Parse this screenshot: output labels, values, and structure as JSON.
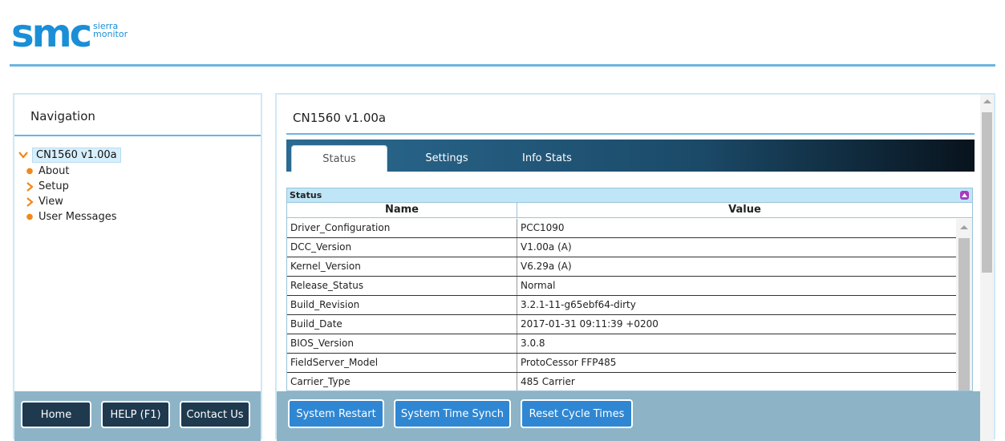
{
  "brand": {
    "logo_text": "smc",
    "logo_sub_line1": "sierra",
    "logo_sub_line2": "monitor",
    "color": "#1a8fd8"
  },
  "nav": {
    "title": "Navigation",
    "root": "CN1560 v1.00a",
    "items": [
      {
        "label": "About",
        "icon": "bullet-icon"
      },
      {
        "label": "Setup",
        "icon": "chevron-right-icon"
      },
      {
        "label": "View",
        "icon": "chevron-right-icon"
      },
      {
        "label": "User Messages",
        "icon": "bullet-icon"
      }
    ],
    "buttons": {
      "home": "Home",
      "help": "HELP (F1)",
      "contact": "Contact Us"
    }
  },
  "main": {
    "title": "CN1560 v1.00a",
    "tabs": [
      {
        "label": "Status",
        "active": true
      },
      {
        "label": "Settings",
        "active": false
      },
      {
        "label": "Info Stats",
        "active": false
      }
    ],
    "status": {
      "heading": "Status",
      "col_name": "Name",
      "col_value": "Value",
      "rows": [
        {
          "name": "Driver_Configuration",
          "value": "PCC1090"
        },
        {
          "name": "DCC_Version",
          "value": "V1.00a (A)"
        },
        {
          "name": "Kernel_Version",
          "value": "V6.29a (A)"
        },
        {
          "name": "Release_Status",
          "value": "Normal"
        },
        {
          "name": "Build_Revision",
          "value": "3.2.1-11-g65ebf64-dirty"
        },
        {
          "name": "Build_Date",
          "value": "2017-01-31 09:11:39 +0200"
        },
        {
          "name": "BIOS_Version",
          "value": "3.0.8"
        },
        {
          "name": "FieldServer_Model",
          "value": "ProtoCessor FFP485"
        },
        {
          "name": "Carrier_Type",
          "value": "485 Carrier"
        }
      ]
    },
    "actions": {
      "restart": "System Restart",
      "time_synch": "System Time Synch",
      "reset_cycle": "Reset Cycle Times"
    }
  },
  "colors": {
    "accent_rule": "#6bb5e0",
    "footer_bg": "#8db3c7",
    "nav_btn": "#1f3a4f",
    "action_btn": "#2f87d3",
    "bullet": "#f08a1c"
  }
}
